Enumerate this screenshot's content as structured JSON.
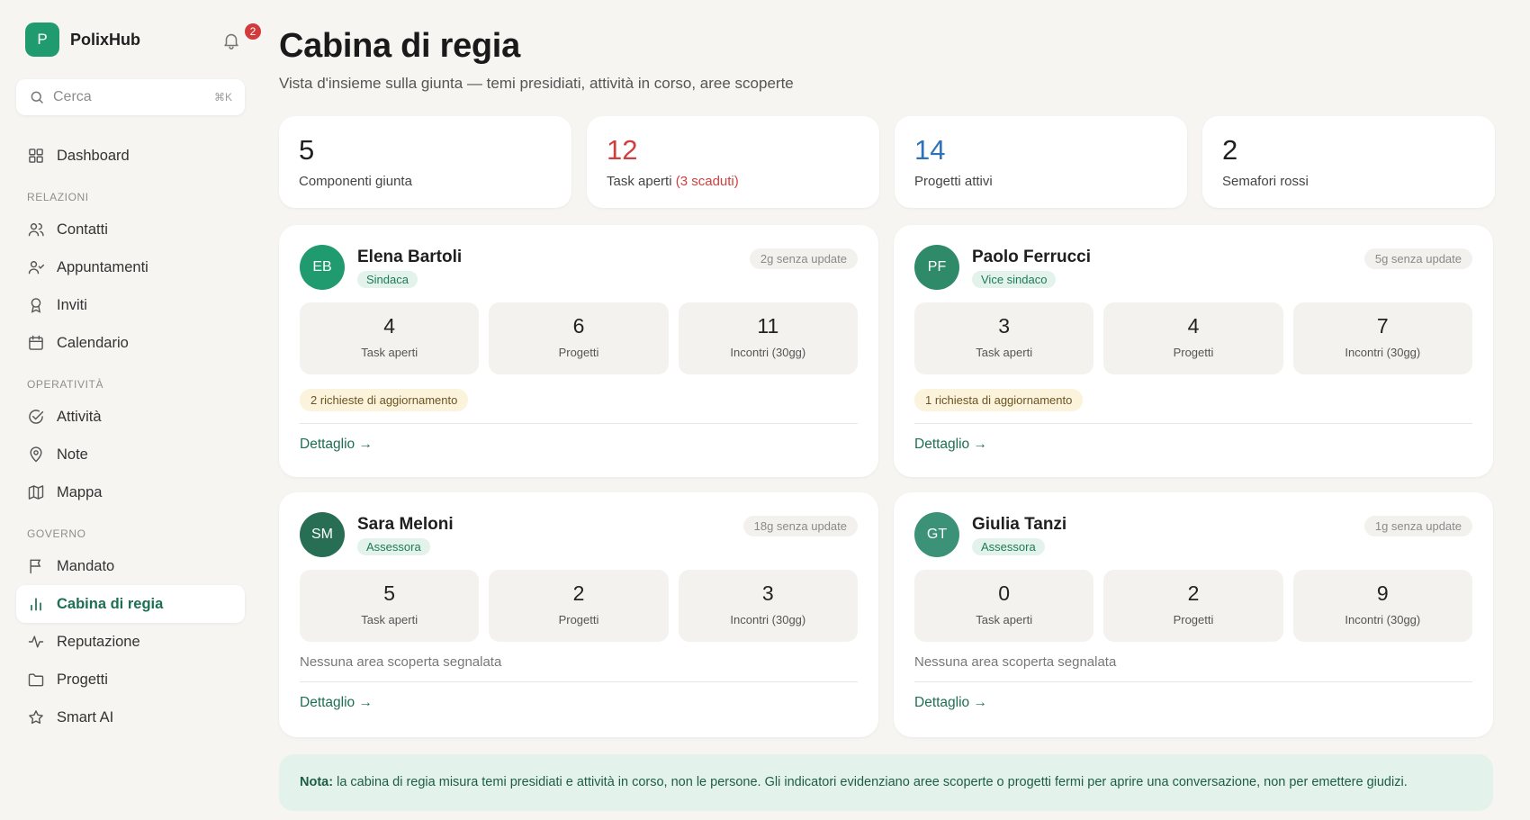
{
  "brand": {
    "logo_letter": "P",
    "name": "PolixHub",
    "notifications": "2"
  },
  "search": {
    "placeholder": "Cerca",
    "shortcut": "⌘K"
  },
  "nav": {
    "dashboard": "Dashboard",
    "sections": {
      "relazioni": "RELAZIONI",
      "operativita": "OPERATIVITÀ",
      "governo": "GOVERNO"
    },
    "contatti": "Contatti",
    "appuntamenti": "Appuntamenti",
    "inviti": "Inviti",
    "calendario": "Calendario",
    "attivita": "Attività",
    "note": "Note",
    "mappa": "Mappa",
    "mandato": "Mandato",
    "cabina": "Cabina di regia",
    "reputazione": "Reputazione",
    "progetti": "Progetti",
    "smart_ai": "Smart AI"
  },
  "header": {
    "title": "Cabina di regia",
    "subtitle": "Vista d'insieme sulla giunta — temi presidiati, attività in corso, aree scoperte"
  },
  "kpis": [
    {
      "value": "5",
      "label": "Componenti giunta"
    },
    {
      "value": "12",
      "label": "Task aperti",
      "extra": "(3 scaduti)"
    },
    {
      "value": "14",
      "label": "Progetti attivi"
    },
    {
      "value": "2",
      "label": "Semafori rossi"
    }
  ],
  "stat_labels": {
    "tasks": "Task aperti",
    "projects": "Progetti",
    "meetings": "Incontri (30gg)"
  },
  "members": [
    {
      "initials": "EB",
      "name": "Elena Bartoli",
      "role": "Sindaca",
      "stale": "2g senza update",
      "tasks": "4",
      "projects": "6",
      "meetings": "11",
      "flag": "2 richieste di aggiornamento",
      "color": "#1f9b6f"
    },
    {
      "initials": "PF",
      "name": "Paolo Ferrucci",
      "role": "Vice sindaco",
      "stale": "5g senza update",
      "tasks": "3",
      "projects": "4",
      "meetings": "7",
      "flag": "1 richiesta di aggiornamento",
      "color": "#2e8a69"
    },
    {
      "initials": "SM",
      "name": "Sara Meloni",
      "role": "Assessora",
      "stale": "18g senza update",
      "tasks": "5",
      "projects": "2",
      "meetings": "3",
      "flag": "Nessuna area scoperta segnalata",
      "color": "#276e55"
    },
    {
      "initials": "GT",
      "name": "Giulia Tanzi",
      "role": "Assessora",
      "stale": "1g senza update",
      "tasks": "0",
      "projects": "2",
      "meetings": "9",
      "flag": "Nessuna area scoperta segnalata",
      "color": "#3b9277"
    }
  ],
  "detail_label": "Dettaglio →",
  "note": {
    "prefix": "Nota:",
    "text": " la cabina di regia misura temi presidiati e attività in corso, non le persone. Gli indicatori evidenziano aree scoperte o progetti fermi per aprire una conversazione, non per emettere giudizi."
  },
  "colors": {
    "accent": "#1f9b6f",
    "danger": "#cf3f3f",
    "info": "#2f72b8"
  }
}
